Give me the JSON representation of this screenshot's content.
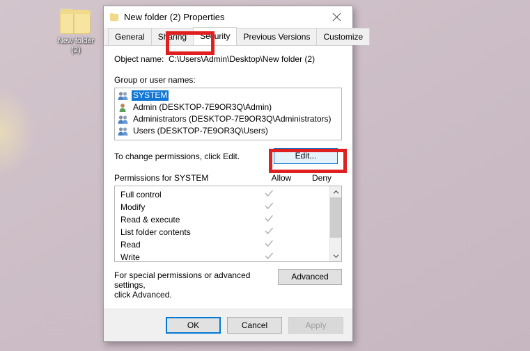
{
  "desktop": {
    "icon": {
      "name": "folder-icon",
      "label_line1": "New folder",
      "label_line2": "(2)"
    },
    "background_color": "#cfc0c8"
  },
  "dialog": {
    "title": "New folder (2) Properties",
    "title_icon": "folder-icon",
    "close_icon": "close-icon",
    "tabs": [
      {
        "label": "General",
        "selected": false
      },
      {
        "label": "Sharing",
        "selected": false
      },
      {
        "label": "Security",
        "selected": true
      },
      {
        "label": "Previous Versions",
        "selected": false
      },
      {
        "label": "Customize",
        "selected": false
      }
    ],
    "object_name": {
      "label": "Object name:",
      "value": "C:\\Users\\Admin\\Desktop\\New folder (2)"
    },
    "group_section": {
      "label": "Group or user names:",
      "items": [
        {
          "label": "SYSTEM",
          "icon": "group-icon",
          "selected": true
        },
        {
          "label": "Admin (DESKTOP-7E9OR3Q\\Admin)",
          "icon": "user-icon",
          "selected": false
        },
        {
          "label": "Administrators (DESKTOP-7E9OR3Q\\Administrators)",
          "icon": "group-icon",
          "selected": false
        },
        {
          "label": "Users (DESKTOP-7E9OR3Q\\Users)",
          "icon": "group-icon",
          "selected": false
        }
      ]
    },
    "edit_hint": "To change permissions, click Edit.",
    "edit_button": "Edit...",
    "permissions": {
      "title": "Permissions for SYSTEM",
      "col_allow": "Allow",
      "col_deny": "Deny",
      "rows": [
        {
          "name": "Full control",
          "allow": "check",
          "deny": ""
        },
        {
          "name": "Modify",
          "allow": "check",
          "deny": ""
        },
        {
          "name": "Read & execute",
          "allow": "check",
          "deny": ""
        },
        {
          "name": "List folder contents",
          "allow": "check",
          "deny": ""
        },
        {
          "name": "Read",
          "allow": "check",
          "deny": ""
        },
        {
          "name": "Write",
          "allow": "check",
          "deny": ""
        }
      ],
      "scrollbar": {
        "up_icon": "chevron-up-icon",
        "down_icon": "chevron-down-icon"
      }
    },
    "advanced_hint_line1": "For special permissions or advanced settings,",
    "advanced_hint_line2": "click Advanced.",
    "advanced_button": "Advanced",
    "footer": {
      "ok": "OK",
      "cancel": "Cancel",
      "apply": "Apply",
      "apply_disabled": true
    }
  },
  "annotations": {
    "highlight_color": "#e02020",
    "items": [
      {
        "name": "security-tab-highlight",
        "target": "Security"
      },
      {
        "name": "edit-button-highlight",
        "target": "Edit..."
      }
    ]
  }
}
